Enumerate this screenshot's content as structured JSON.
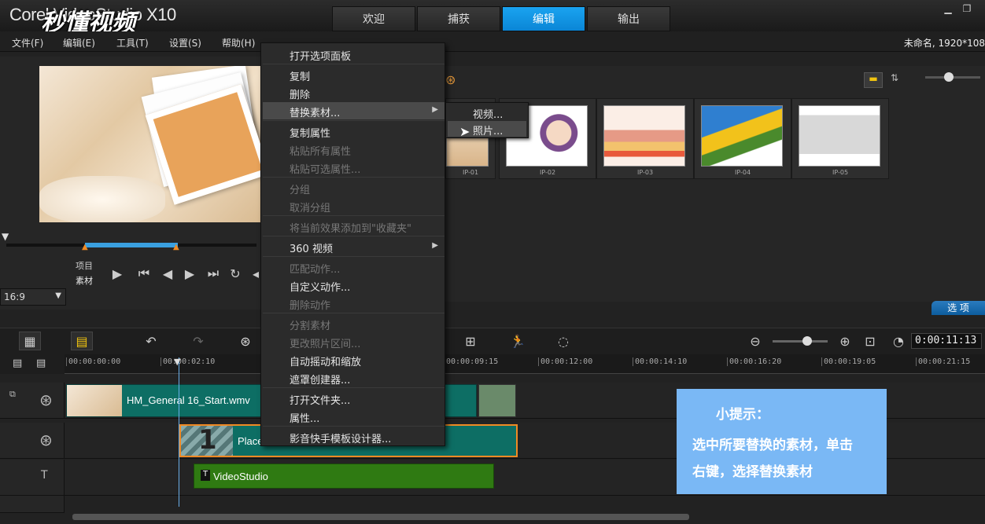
{
  "app": {
    "logo_text": "Corel VideoStudio X10",
    "watermark": "秒懂视频",
    "top_tabs": [
      {
        "label": "欢迎"
      },
      {
        "label": "捕获"
      },
      {
        "label": "编辑"
      },
      {
        "label": "输出"
      }
    ],
    "active_tab": "编辑",
    "project_info": "未命名, 1920*108"
  },
  "menubar": {
    "items": [
      {
        "label": "文件(F)"
      },
      {
        "label": "编辑(E)"
      },
      {
        "label": "工具(T)"
      },
      {
        "label": "设置(S)"
      },
      {
        "label": "帮助(H)"
      }
    ]
  },
  "player": {
    "project_label": "项目",
    "clip_label": "素材",
    "aspect_ratio": "16:9"
  },
  "library": {
    "thumbnails": [
      {
        "label": "IP-01"
      },
      {
        "label": "IP-02"
      },
      {
        "label": "IP-03"
      },
      {
        "label": "IP-04"
      },
      {
        "label": "IP-05"
      }
    ],
    "options_label": "选 项"
  },
  "context_menu": {
    "items": [
      {
        "label": "打开选项面板",
        "disabled": false
      },
      {
        "label": "复制",
        "disabled": false
      },
      {
        "label": "删除",
        "disabled": false
      },
      {
        "label": "替换素材...",
        "disabled": false,
        "highlighted": true,
        "submenu": true
      },
      {
        "label": "复制属性",
        "disabled": false
      },
      {
        "label": "粘贴所有属性",
        "disabled": true
      },
      {
        "label": "粘贴可选属性...",
        "disabled": true
      },
      {
        "label": "分组",
        "disabled": true
      },
      {
        "label": "取消分组",
        "disabled": true
      },
      {
        "label": "将当前效果添加到\"收藏夹\"",
        "disabled": true
      },
      {
        "label": "360 视频",
        "disabled": false,
        "submenu": true
      },
      {
        "label": "匹配动作...",
        "disabled": true
      },
      {
        "label": "自定义动作...",
        "disabled": false
      },
      {
        "label": "删除动作",
        "disabled": true
      },
      {
        "label": "分割素材",
        "disabled": true
      },
      {
        "label": "更改照片区间...",
        "disabled": true
      },
      {
        "label": "自动摇动和缩放",
        "disabled": false
      },
      {
        "label": "遮罩创建器...",
        "disabled": false
      },
      {
        "label": "打开文件夹...",
        "disabled": false
      },
      {
        "label": "属性...",
        "disabled": false
      },
      {
        "label": "影音快手模板设计器...",
        "disabled": false
      }
    ],
    "submenu": [
      {
        "label": "视频..."
      },
      {
        "label": "照片...",
        "highlighted": true
      }
    ]
  },
  "timeline": {
    "timecode": "0:00:11:13",
    "ruler": [
      "00:00:00:00",
      "00:00:02:10",
      "00:00:09:15",
      "00:00:12:00",
      "00:00:14:10",
      "00:00:16:20",
      "00:00:19:05",
      "00:00:21:15"
    ],
    "video_clip": "HM_General 16_Start.wmv",
    "overlay_clip": "Place",
    "overlay_number": "1",
    "title_clip": "VideoStudio"
  },
  "tip": {
    "title": "小提示：",
    "line1": "选中所要替换的素材，单击",
    "line2": "右键，选择替换素材"
  },
  "colors": {
    "accent": "#0a86d6",
    "tip_bg": "#7ab8f5",
    "video_clip": "#0d6e64",
    "title_clip": "#2f7a12"
  }
}
